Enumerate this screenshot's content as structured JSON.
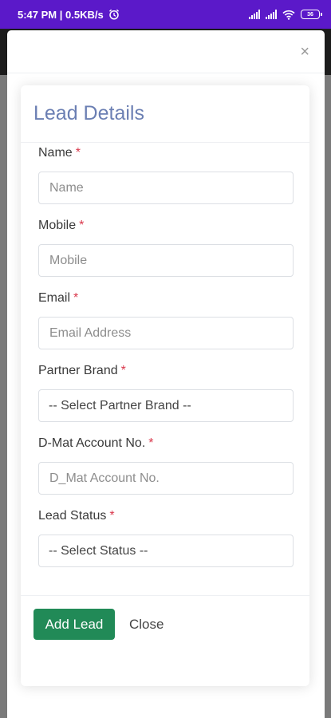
{
  "status_bar": {
    "time_speed": "5:47 PM | 0.5KB/s",
    "alarm_icon": "alarm-clock-icon",
    "battery_level": "36",
    "bar_color": "#5b19c9"
  },
  "modal": {
    "close_label": "×",
    "title": "Lead Details",
    "required_mark": "*",
    "fields": [
      {
        "label": "Name",
        "placeholder": "Name"
      },
      {
        "label": "Mobile",
        "placeholder": "Mobile"
      },
      {
        "label": "Email",
        "placeholder": "Email Address"
      },
      {
        "label": "Partner Brand",
        "selected": "-- Select Partner Brand --"
      },
      {
        "label": "D-Mat Account No.",
        "placeholder": "D_Mat Account No."
      },
      {
        "label": "Lead Status",
        "selected": "-- Select Status --"
      }
    ],
    "add_button": "Add Lead",
    "close_button": "Close",
    "accent_color": "#218a57"
  }
}
